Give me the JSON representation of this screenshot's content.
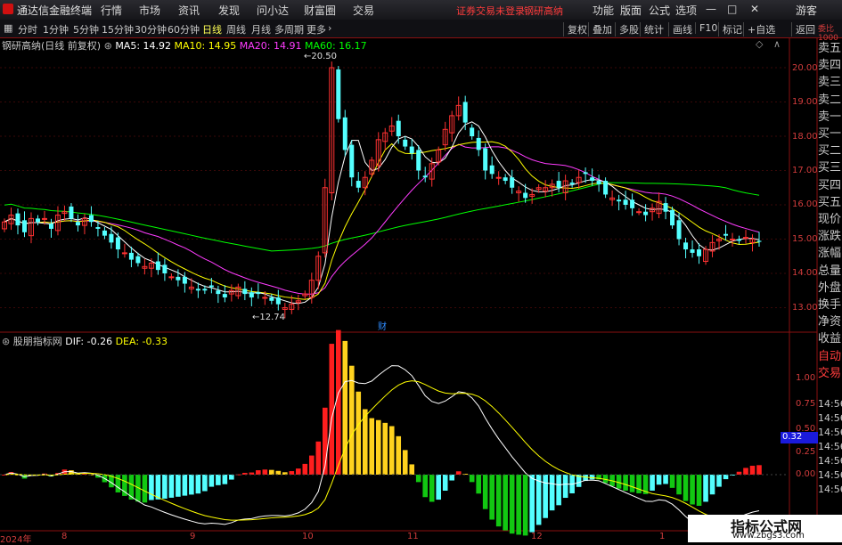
{
  "titlebar": {
    "app_name": "通达信金融终端",
    "menus": [
      "行情",
      "市场",
      "资讯",
      "发现",
      "问小达",
      "财富圈",
      "交易"
    ],
    "warning": "证券交易未登录",
    "stock_name": "钢研高纳",
    "right_menus": [
      "功能",
      "版面",
      "公式",
      "选项"
    ],
    "guest": "游客"
  },
  "toolbar": {
    "periods": [
      "分时",
      "1分钟",
      "5分钟",
      "15分钟",
      "30分钟",
      "60分钟",
      "日线",
      "周线",
      "月线",
      "多周期",
      "更多"
    ],
    "active_period": "日线",
    "buttons": [
      "复权",
      "叠加",
      "多股",
      "统计",
      "画线",
      "F10",
      "标记",
      "+自选",
      "返回"
    ]
  },
  "main_chart": {
    "title": "钢研高纳(日线 前复权)",
    "ma": [
      {
        "label": "MA5: 14.92",
        "color": "#ffffff"
      },
      {
        "label": "MA10: 14.95",
        "color": "#ffff00"
      },
      {
        "label": "MA20: 14.91",
        "color": "#ff3cff"
      },
      {
        "label": "MA60: 16.17",
        "color": "#00ff00"
      }
    ],
    "yticks": [
      "20.00",
      "19.00",
      "18.00",
      "17.00",
      "16.00",
      "15.00",
      "14.00",
      "13.00"
    ],
    "high_label": "20.50",
    "low_label": "12.74",
    "event_marker": "财"
  },
  "macd_chart": {
    "title": "股朋指标网",
    "dif_label": "DIF: -0.26",
    "dea_label": "DEA: -0.33",
    "yticks": [
      "1.00",
      "0.75",
      "0.50",
      "0.25",
      "0.00"
    ],
    "current_value": "0.32"
  },
  "xaxis": {
    "labels": [
      "2024年",
      "8",
      "9",
      "10",
      "11",
      "12",
      "1"
    ]
  },
  "right_panel": {
    "top_label": "委比",
    "unit": "1000",
    "items": [
      "卖五",
      "卖四",
      "卖三",
      "卖二",
      "卖一",
      "买一",
      "买二",
      "买三",
      "买四",
      "买五",
      "现价",
      "涨跌",
      "涨幅",
      "总量",
      "外盘",
      "换手",
      "净资",
      "收益",
      "自动",
      "交易"
    ],
    "times": [
      "14:56",
      "14:56",
      "14:56",
      "14:56",
      "14:56",
      "14:56",
      "14:56"
    ]
  },
  "watermark": {
    "line1": "指标公式网",
    "line2": "www.zbgs3.com"
  },
  "colors": {
    "up": "#ff3232",
    "down": "#54ffff",
    "ma5": "#ffffff",
    "ma10": "#ffff00",
    "ma20": "#ff3cff",
    "ma60": "#00ff00",
    "axis": "#d23c3c"
  },
  "chart_data": {
    "type": "candlestick",
    "close": [
      15.5,
      15.7,
      15.4,
      15.2,
      15.6,
      15.5,
      15.6,
      15.3,
      15.7,
      15.8,
      15.6,
      15.4,
      15.6,
      15.5,
      15.3,
      15.1,
      14.9,
      14.7,
      14.6,
      14.4,
      14.3,
      14.2,
      14.3,
      14.1,
      14.0,
      13.9,
      13.8,
      13.7,
      13.6,
      13.5,
      13.5,
      13.6,
      13.4,
      13.3,
      13.5,
      13.6,
      13.4,
      13.3,
      13.4,
      13.3,
      13.2,
      13.1,
      13.0,
      13.1,
      13.2,
      13.4,
      13.8,
      14.5,
      16.5,
      20.0,
      18.5,
      17.6,
      16.8,
      16.5,
      16.8,
      17.3,
      17.9,
      18.1,
      18.3,
      18.0,
      17.7,
      17.5,
      17.0,
      16.8,
      17.2,
      17.6,
      18.2,
      18.6,
      18.9,
      18.4,
      18.0,
      17.6,
      17.0,
      16.9,
      16.8,
      16.7,
      16.5,
      16.4,
      16.2,
      16.3,
      16.5,
      16.5,
      16.6,
      16.5,
      16.7,
      16.6,
      16.8,
      16.9,
      16.7,
      16.6,
      16.3,
      16.2,
      16.1,
      16.0,
      15.9,
      15.8,
      15.7,
      15.9,
      16.1,
      15.8,
      15.4,
      15.0,
      14.7,
      14.6,
      14.5,
      14.7,
      14.9,
      15.0,
      15.1,
      15.0,
      14.95,
      15.05,
      15.0,
      14.92
    ]
  }
}
